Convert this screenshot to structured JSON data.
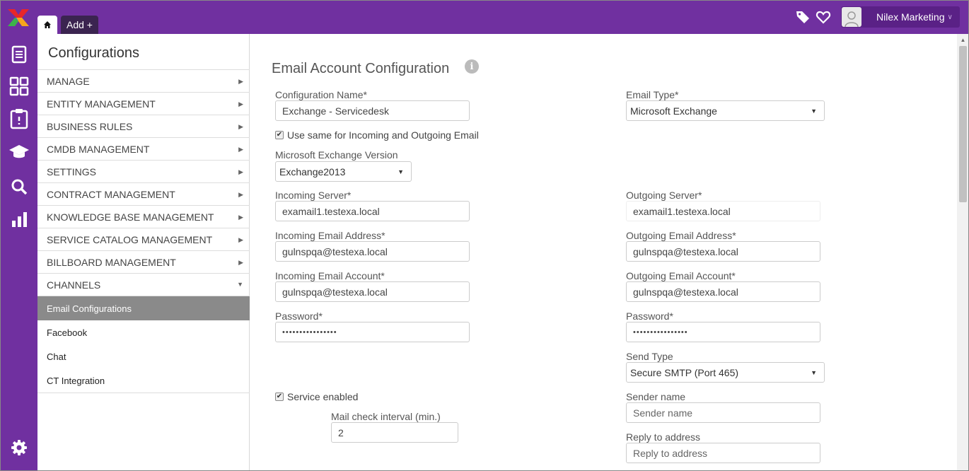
{
  "topbar": {
    "tabs": {
      "add_label": "Add +"
    },
    "user_name": "Nilex Marketing"
  },
  "sidebar": {
    "title": "Configurations",
    "menu": [
      "MANAGE",
      "ENTITY MANAGEMENT",
      "BUSINESS RULES",
      "CMDB MANAGEMENT",
      "SETTINGS",
      "CONTRACT MANAGEMENT",
      "KNOWLEDGE BASE MANAGEMENT",
      "SERVICE CATALOG MANAGEMENT",
      "BILLBOARD MANAGEMENT",
      "CHANNELS"
    ],
    "channels": [
      "Email Configurations",
      "Facebook",
      "Chat",
      "CT Integration"
    ]
  },
  "form": {
    "title": "Email Account Configuration",
    "config_name_label": "Configuration Name*",
    "config_name_value": "Exchange - Servicedesk",
    "email_type_label": "Email Type*",
    "email_type_value": "Microsoft Exchange",
    "use_same_label": "Use same for Incoming and Outgoing Email",
    "use_same_checked": true,
    "exchange_version_label": "Microsoft Exchange Version",
    "exchange_version_value": "Exchange2013",
    "incoming_server_label": "Incoming Server*",
    "incoming_server_value": "examail1.testexa.local",
    "outgoing_server_label": "Outgoing Server*",
    "outgoing_server_value": "examail1.testexa.local",
    "incoming_email_label": "Incoming Email Address*",
    "incoming_email_value": "gulnspqa@testexa.local",
    "outgoing_email_label": "Outgoing Email Address*",
    "outgoing_email_value": "gulnspqa@testexa.local",
    "incoming_account_label": "Incoming Email Account*",
    "incoming_account_value": "gulnspqa@testexa.local",
    "outgoing_account_label": "Outgoing Email Account*",
    "outgoing_account_value": "gulnspqa@testexa.local",
    "password_label": "Password*",
    "incoming_password_value": "••••••••••••••••",
    "outgoing_password_value": "••••••••••••••••",
    "send_type_label": "Send Type",
    "send_type_value": "Secure SMTP (Port 465)",
    "service_enabled_label": "Service enabled",
    "service_enabled_checked": true,
    "mail_interval_label": "Mail check interval (min.)",
    "mail_interval_value": "2",
    "sender_name_label": "Sender name",
    "sender_name_placeholder": "Sender name",
    "reply_to_label": "Reply to address",
    "reply_to_placeholder": "Reply to address"
  },
  "colors": {
    "brand_purple": "#7030a0",
    "active_item": "#8a8a8a"
  },
  "icons": {
    "rail": [
      "document-icon",
      "dashboard-grid-icon",
      "clipboard-icon",
      "graduation-cap-icon",
      "search-icon",
      "bar-chart-icon",
      "gear-icon"
    ],
    "topbar": [
      "tag-icon",
      "heart-icon",
      "user-icon"
    ]
  }
}
